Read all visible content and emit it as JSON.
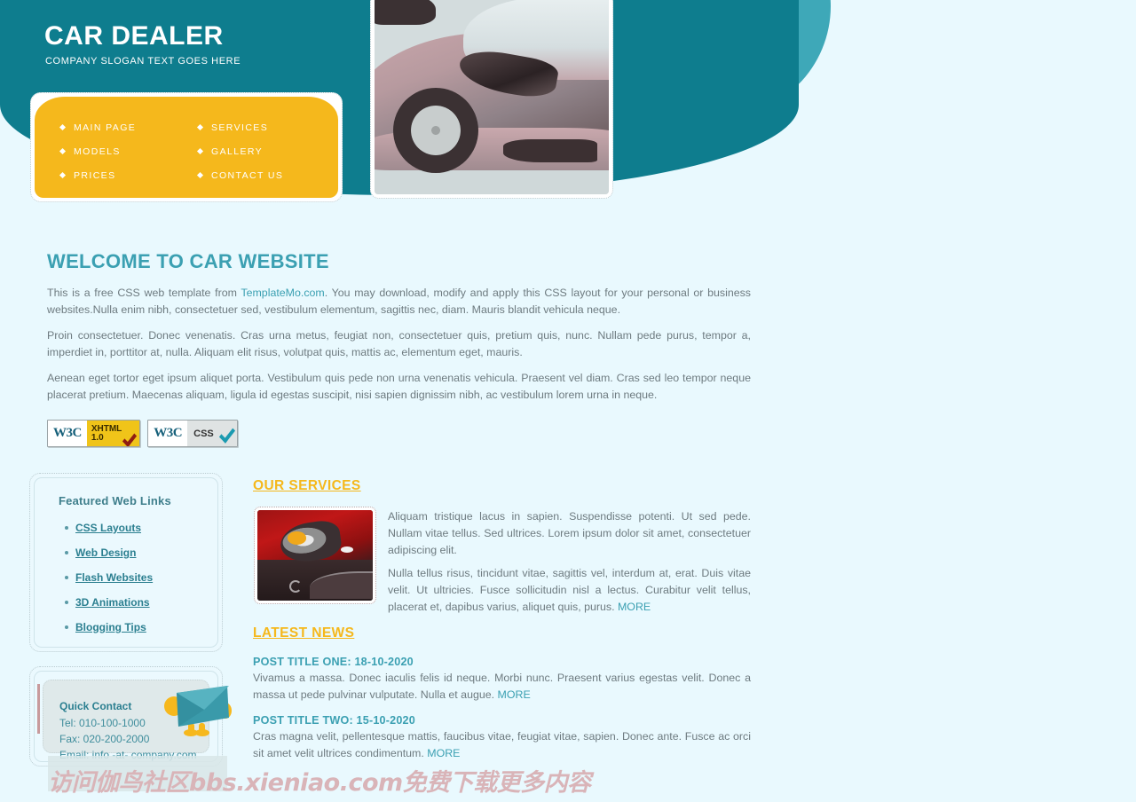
{
  "header": {
    "title": "CAR DEALER",
    "slogan": "COMPANY SLOGAN TEXT GOES HERE",
    "menu": [
      {
        "label": "MAIN PAGE"
      },
      {
        "label": "MODELS"
      },
      {
        "label": "PRICES"
      },
      {
        "label": "SERVICES"
      },
      {
        "label": "GALLERY"
      },
      {
        "label": "CONTACT US"
      }
    ],
    "car_photo_alt": "silver car front close-up"
  },
  "welcome": {
    "title": "WELCOME TO CAR WEBSITE",
    "para1_before": "This is a free CSS web template from ",
    "para1_link": "TemplateMo.com",
    "para1_after": ". You may download, modify and apply this CSS layout for your personal or business websites.Nulla enim nibh, consectetuer sed, vestibulum elementum, sagittis nec, diam. Mauris blandit vehicula neque.",
    "para2": "Proin consectetuer. Donec venenatis. Cras urna metus, feugiat non, consectetuer quis, pretium quis, nunc. Nullam pede purus, tempor a, imperdiet in, porttitor at, nulla. Aliquam elit risus, volutpat quis, mattis ac, elementum eget, mauris.",
    "para3": "Aenean eget tortor eget ipsum aliquet porta. Vestibulum quis pede non urna venenatis vehicula. Praesent vel diam. Cras sed leo tempor neque placerat pretium. Maecenas aliquam, ligula id egestas suscipit, nisi sapien dignissim nibh, ac vestibulum lorem urna in neque."
  },
  "badges": {
    "xhtml_w3c": "W3C",
    "xhtml_kind_line1": "XHTML",
    "xhtml_kind_line2": "1.0",
    "css_w3c": "W3C",
    "css_kind": "CSS"
  },
  "sidebar": {
    "featured_title": "Featured Web Links",
    "featured_links": [
      {
        "label": "CSS Layouts"
      },
      {
        "label": "Web Design"
      },
      {
        "label": "Flash Websites"
      },
      {
        "label": "3D Animations"
      },
      {
        "label": "Blogging Tips"
      }
    ],
    "contact_title": "Quick Contact",
    "contact_tel": "Tel: 010-100-1000",
    "contact_fax": "Fax: 020-200-2000",
    "contact_email": "Email: info -at- company.com",
    "envelope_icon": "envelope-mascot-icon"
  },
  "services": {
    "title": "OUR SERVICES",
    "image_alt": "red car headlight close-up",
    "para1": "Aliquam tristique lacus in sapien. Suspendisse potenti. Ut sed pede. Nullam vitae tellus. Sed ultrices. Lorem ipsum dolor sit amet, consectetuer adipiscing elit.",
    "para2": "Nulla tellus risus, tincidunt vitae, sagittis vel, interdum at, erat. Duis vitae velit. Ut ultricies. Fusce sollicitudin nisl a lectus. Curabitur velit tellus, placerat et, dapibus varius, aliquet quis, purus. ",
    "more_label": "MORE"
  },
  "news": {
    "title": "LATEST NEWS",
    "posts": [
      {
        "title": "POST TITLE ONE: 18-10-2020",
        "body": "Vivamus a massa. Donec iaculis felis id neque. Morbi nunc. Praesent varius egestas velit. Donec a massa ut pede pulvinar vulputate. Nulla et augue. ",
        "more_label": "MORE"
      },
      {
        "title": "POST TITLE TWO: 15-10-2020",
        "body": "Cras magna velit, pellentesque mattis, faucibus vitae, feugiat vitae, sapien. Donec ante. Fusce ac orci sit amet velit ultrices condimentum. ",
        "more_label": "MORE"
      }
    ]
  },
  "watermark": {
    "text": "访问伽鸟社区bbs.xieniao.com免费下载更多内容"
  },
  "colors": {
    "header_teal": "#0e7d8e",
    "accent_yellow": "#f5b81c",
    "link_teal": "#3ba0b2",
    "page_bg": "#e9f9fe",
    "body_text": "#6e7b80"
  }
}
